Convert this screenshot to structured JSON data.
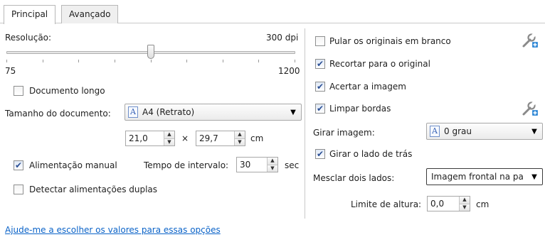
{
  "tabs": {
    "principal": "Principal",
    "avancado": "Avançado"
  },
  "resolution": {
    "label": "Resolução:",
    "value_text": "300 dpi",
    "min_label": "75",
    "max_label": "1200",
    "value": 300,
    "min": 75,
    "max": 1200
  },
  "documento_longo": {
    "label": "Documento longo",
    "checked": false
  },
  "tamanho": {
    "label": "Tamanho do documento:",
    "value": "A4 (Retrato)"
  },
  "dimensions": {
    "width": "21,0",
    "times": "×",
    "height": "29,7",
    "unit": "cm"
  },
  "alimentacao_manual": {
    "label": "Alimentação manual",
    "checked": true
  },
  "tempo": {
    "label": "Tempo de intervalo:",
    "value": "30",
    "unit": "sec"
  },
  "detectar": {
    "label": "Detectar alimentações duplas",
    "checked": false
  },
  "help_link": "Ajude-me a escolher os valores para essas opções",
  "right": {
    "pular": {
      "label": "Pular os originais em branco",
      "checked": false
    },
    "recortar": {
      "label": "Recortar para o original",
      "checked": true
    },
    "acertar": {
      "label": "Acertar a imagem",
      "checked": true
    },
    "limpar": {
      "label": "Limpar bordas",
      "checked": true
    },
    "girar": {
      "label": "Girar imagem:",
      "value": "0 grau"
    },
    "girar_tras": {
      "label": "Girar o lado de trás",
      "checked": true
    },
    "mesclar": {
      "label": "Mesclar dois lados:",
      "value": "Imagem frontal na pa"
    },
    "limite": {
      "label": "Limite de altura:",
      "value": "0,0",
      "unit": "cm"
    }
  },
  "icons": {
    "checkmark": "✔",
    "dropdown": "▼",
    "spin_up": "▲",
    "spin_down": "▼",
    "document": "A",
    "wrench": "wrench-settings-icon"
  },
  "colors": {
    "link": "#0b63c8",
    "accent": "#2a4f95"
  }
}
